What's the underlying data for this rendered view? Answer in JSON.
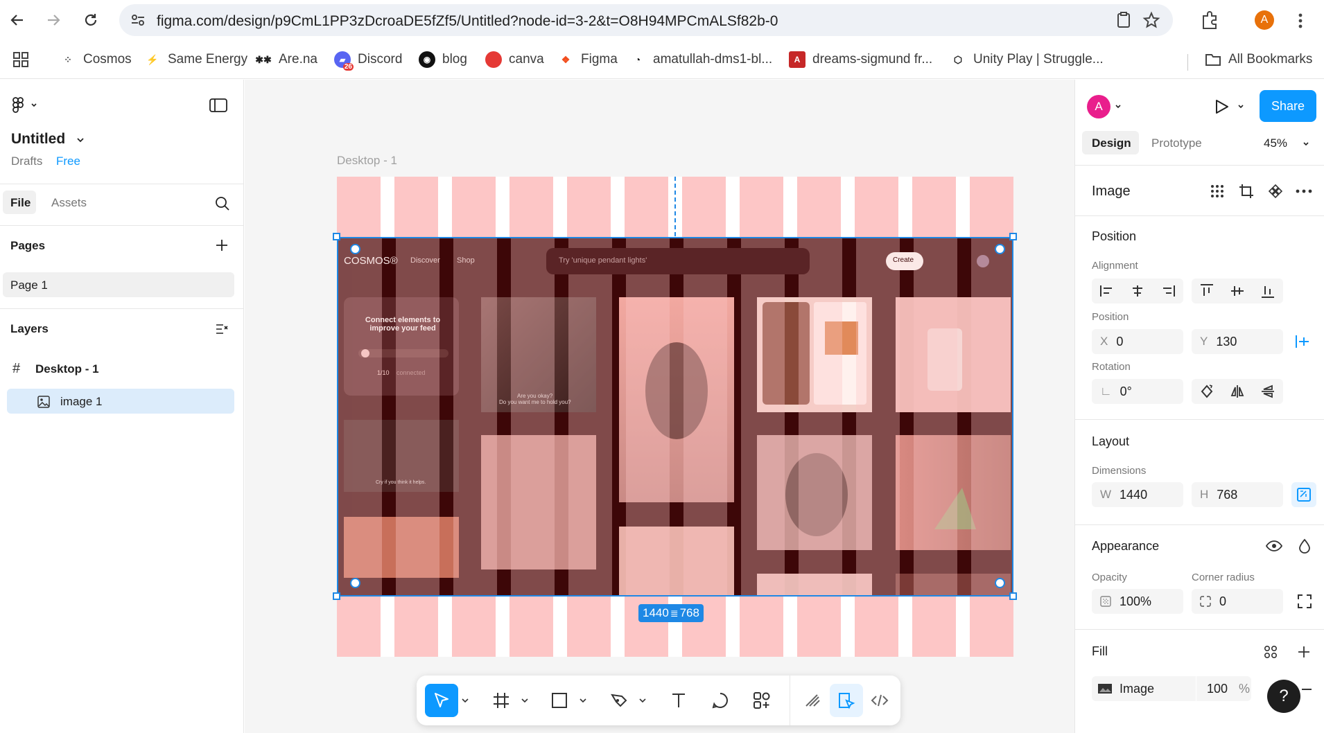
{
  "browser": {
    "url": "figma.com/design/p9CmL1PP3zDcroaDE5fZf5/Untitled?node-id=3-2&t=O8H94MPCmALSf82b-0",
    "profile_initial": "A",
    "bookmarks": [
      {
        "label": "Cosmos",
        "icon": "cosmos-icon"
      },
      {
        "label": "Same Energy",
        "icon": "same-energy-icon"
      },
      {
        "label": "Are.na",
        "icon": "arena-icon"
      },
      {
        "label": "Discord",
        "icon": "discord-icon",
        "badge": "26"
      },
      {
        "label": "blog",
        "icon": "github-icon"
      },
      {
        "label": "canva",
        "icon": "canva-icon"
      },
      {
        "label": "Figma",
        "icon": "figma-icon"
      },
      {
        "label": "amatullah-dms1-bl...",
        "icon": "github-icon"
      },
      {
        "label": "dreams-sigmund fr...",
        "icon": "pdf-icon"
      },
      {
        "label": "Unity Play | Struggle...",
        "icon": "unity-icon"
      }
    ],
    "all_bookmarks": "All Bookmarks"
  },
  "left_panel": {
    "file_name": "Untitled",
    "drafts": "Drafts",
    "plan": "Free",
    "tabs": {
      "file": "File",
      "assets": "Assets"
    },
    "pages_title": "Pages",
    "pages": [
      "Page 1"
    ],
    "layers_title": "Layers",
    "layers": [
      {
        "name": "Desktop - 1",
        "type": "frame"
      },
      {
        "name": "image 1",
        "type": "image"
      }
    ]
  },
  "canvas": {
    "frame_label": "Desktop - 1",
    "dimension_badge": {
      "w": "1440",
      "h": "768"
    },
    "image": {
      "brand": "COSMOS®",
      "nav": [
        "Discover",
        "Shop"
      ],
      "search_placeholder": "Try 'unique pendant lights'",
      "create_label": "Create",
      "connect_title": "Connect elements to improve your feed",
      "connect_count": "1/10",
      "connect_suffix": "connected",
      "caption_1a": "Are you okay?",
      "caption_1b": "Do you want me to hold you?",
      "caption_2": "Cry if you think it helps."
    }
  },
  "right_panel": {
    "user_initial": "A",
    "share": "Share",
    "tabs": {
      "design": "Design",
      "prototype": "Prototype"
    },
    "zoom": "45%",
    "selection_type": "Image",
    "position": {
      "title": "Position",
      "alignment_label": "Alignment",
      "position_label": "Position",
      "x_label": "X",
      "x": "0",
      "y_label": "Y",
      "y": "130",
      "rotation_label": "Rotation",
      "rotation": "0°"
    },
    "layout": {
      "title": "Layout",
      "dimensions_label": "Dimensions",
      "w_label": "W",
      "w": "1440",
      "h_label": "H",
      "h": "768"
    },
    "appearance": {
      "title": "Appearance",
      "opacity_label": "Opacity",
      "opacity": "100%",
      "radius_label": "Corner radius",
      "radius": "0"
    },
    "fill": {
      "title": "Fill",
      "type": "Image",
      "opacity": "100",
      "unit": "%"
    },
    "help": "?"
  },
  "colors": {
    "accent": "#0d99ff",
    "selection": "#1e88e5",
    "layout_grid": "#fdc6c6",
    "image_bg": "#3d0708",
    "avatar": "#e8710a"
  }
}
